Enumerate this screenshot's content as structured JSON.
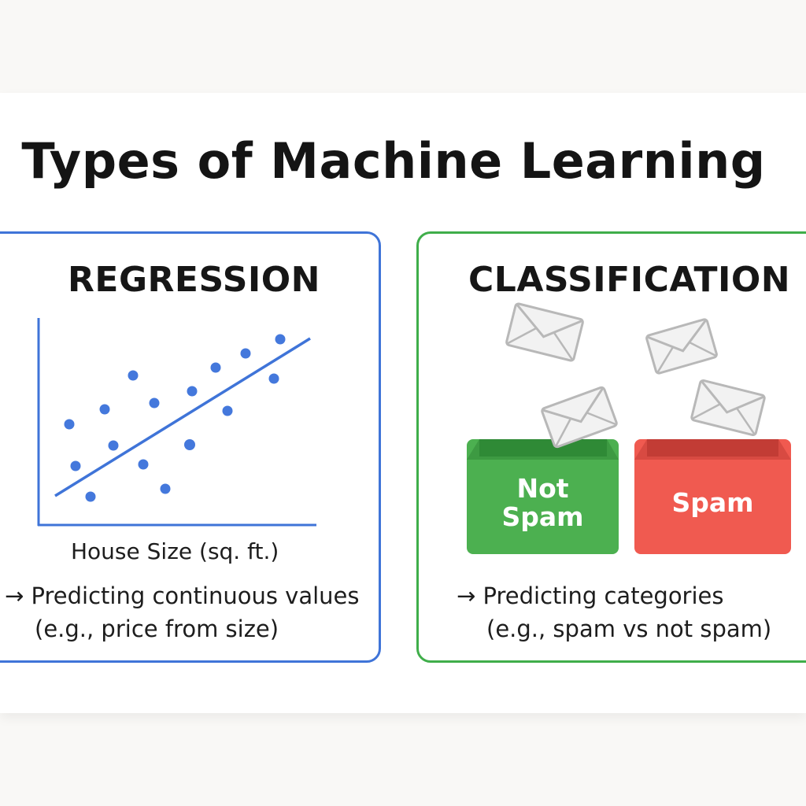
{
  "title": "Types of Machine Learning",
  "regression": {
    "heading": "REGRESSION",
    "x_axis_label": "House Size (sq. ft.)",
    "arrow": "→",
    "description_line1": "Predicting continuous values",
    "description_line2": "(e.g., price from size)",
    "accent_color": "#3f74d8"
  },
  "classification": {
    "heading": "CLASSIFICATION",
    "arrow": "→",
    "description_line1": "Predicting categories",
    "description_line2": "(e.g., spam vs not spam)",
    "accent_color": "#3fae4a",
    "bins": {
      "not_spam": "Not Spam",
      "spam": "Spam",
      "not_spam_color": "#4cb050",
      "spam_color": "#f05a50"
    },
    "icons": [
      "envelope-icon",
      "envelope-icon",
      "envelope-icon",
      "envelope-icon"
    ]
  }
}
